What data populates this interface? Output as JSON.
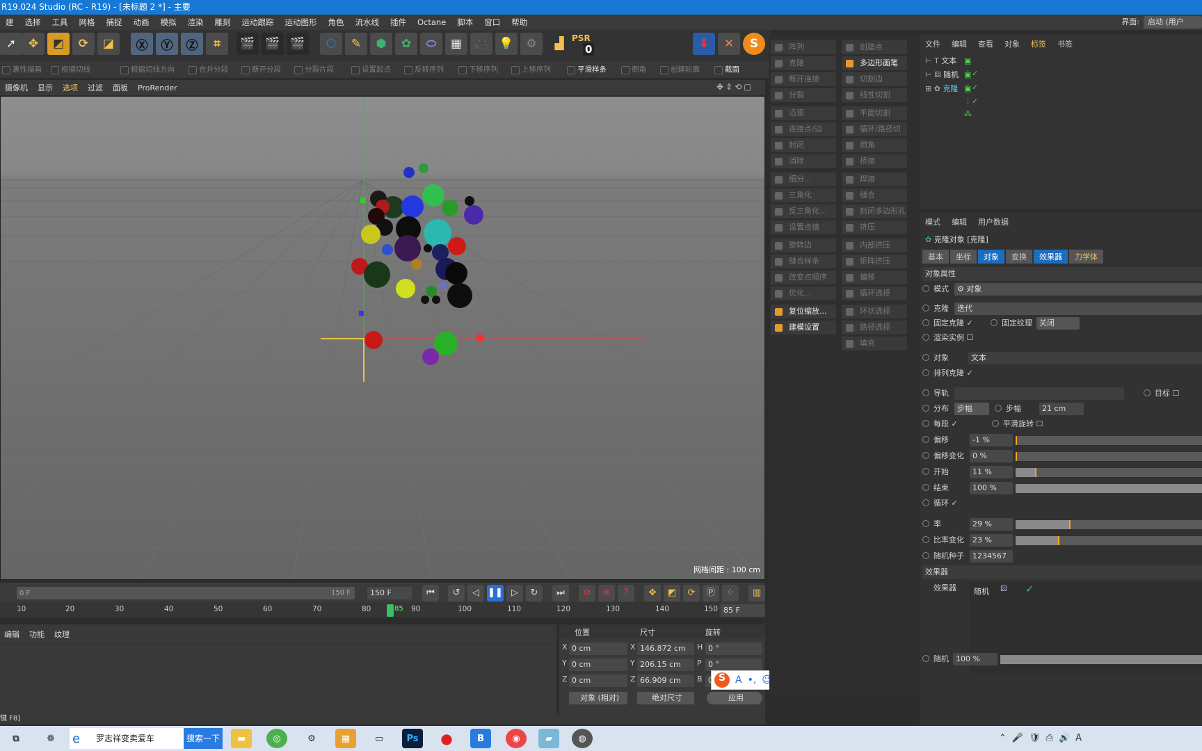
{
  "title": "R19.024 Studio (RC - R19) - [未标题 2 *] - 主要",
  "menu": [
    "建",
    "选择",
    "工具",
    "网格",
    "捕捉",
    "动画",
    "模拟",
    "渲染",
    "雕刻",
    "运动跟踪",
    "运动图形",
    "角色",
    "流水线",
    "插件",
    "Octane",
    "脚本",
    "窗口",
    "帮助"
  ],
  "ui_label": "界面:",
  "ui_value": "启动 (用户",
  "psr": {
    "label": "PSR",
    "value": "0"
  },
  "toolbar2": [
    "裹性描画",
    "根据切线",
    "根据切线方向",
    "合并分段",
    "断开分段",
    "分裂片段",
    "设置起点",
    "反转序列",
    "下移序列",
    "上移序列",
    "平滑样条",
    "倒角",
    "创建轮廓",
    "截面"
  ],
  "viewport_menu": [
    "摄像机",
    "显示",
    "选项",
    "过滤",
    "面板",
    "ProRender"
  ],
  "grid_label": "网格间距 : 100 cm",
  "timeline": {
    "start": "0 F",
    "end": "150 F",
    "end2": "150 F",
    "current": "85 F",
    "marker": "85",
    "ticks": [
      "10",
      "20",
      "30",
      "40",
      "50",
      "60",
      "70",
      "80",
      "90",
      "100",
      "110",
      "120",
      "130",
      "140",
      "150"
    ]
  },
  "lower_tabs": [
    "编辑",
    "功能",
    "纹理"
  ],
  "coords": {
    "headers": [
      "位置",
      "尺寸",
      "旋转"
    ],
    "rows": [
      {
        "a": "X",
        "pos": "0 cm",
        "s": "X",
        "size": "146.872 cm",
        "r": "H",
        "rot": "0 °"
      },
      {
        "a": "Y",
        "pos": "0 cm",
        "s": "Y",
        "size": "206.15 cm",
        "r": "P",
        "rot": "0 °"
      },
      {
        "a": "Z",
        "pos": "0 cm",
        "s": "Z",
        "size": "66.909 cm",
        "r": "B",
        "rot": "0 °"
      }
    ],
    "mode": "对象 (相对)",
    "size_mode": "绝对尺寸",
    "apply": "应用"
  },
  "status": "键 F8]",
  "tools_col1": [
    "阵列",
    "克隆",
    "断开连接",
    "分裂",
    "沿现",
    "连接点/边",
    "封闭",
    "消除",
    "细分...",
    "三角化",
    "反三角化...",
    "设置点值",
    "旋转边",
    "缝合样条",
    "改变点顺序",
    "优化...",
    "复位缩放...",
    "建模设置"
  ],
  "tools_col2": [
    "创建点",
    "多边形画笔",
    "切割边",
    "线性切割",
    "平面切割",
    "循环/路径切割",
    "倒角",
    "桥接",
    "焊接",
    "缝合",
    "封闭多边形孔洞",
    "挤压",
    "内部挤压",
    "矩阵挤压",
    "偏移",
    "循环选择",
    "环状选择",
    "路径选择",
    "填充"
  ],
  "obj_menu": [
    "文件",
    "编辑",
    "查看",
    "对象",
    "标签",
    "书签"
  ],
  "objects": [
    {
      "name": "文本"
    },
    {
      "name": "随机"
    },
    {
      "name": "克隆"
    }
  ],
  "attr_menu": [
    "模式",
    "编辑",
    "用户数据"
  ],
  "attr_title": "克隆对象 [克隆]",
  "attr_tabs": [
    "基本",
    "坐标",
    "对象",
    "变换",
    "效果器",
    "力学体"
  ],
  "attr": {
    "section": "对象属性",
    "mode_label": "模式",
    "mode_value": "对象",
    "clone_label": "克隆",
    "clone_value": "迭代",
    "fixed_clone": "固定克隆",
    "fixed_tex": "固定纹理",
    "fixed_tex_value": "关闭",
    "render_inst": "渲染实例",
    "object_label": "对象",
    "object_value": "文本",
    "arrange": "排列克隆",
    "guide": "导轨",
    "target": "目标",
    "dist_label": "分布",
    "dist_value": "步幅",
    "step_label": "步幅",
    "step_value": "21 cm",
    "per_seg": "每段",
    "smooth_rot": "平滑旋转",
    "offset_label": "偏移",
    "offset_value": "-1 %",
    "offset_var_label": "偏移变化",
    "offset_var_value": "0 %",
    "start_label": "开始",
    "start_value": "11 %",
    "end_label": "结束",
    "end_value": "100 %",
    "loop": "循环",
    "rate_label": "率",
    "rate_value": "29 %",
    "rate_var_label": "比率变化",
    "rate_var_value": "23 %",
    "seed_label": "随机种子",
    "seed_value": "1234567",
    "effectors_section": "效果器",
    "effectors_label": "效果器",
    "effector_name": "随机",
    "random_label": "随机",
    "random_value": "100 %"
  },
  "sliders": {
    "offset": 0.0,
    "offset_var": 0.0,
    "start": 0.11,
    "rate": 0.29,
    "rate_var": 0.23,
    "random": 1.0
  },
  "taskbar": {
    "search_text": "罗志祥变卖爱车",
    "search_btn": "搜索一下"
  },
  "colors": {
    "accent": "#1679d6",
    "slider_mark": "#f5a623",
    "active_tab": "#1c6dbf"
  }
}
